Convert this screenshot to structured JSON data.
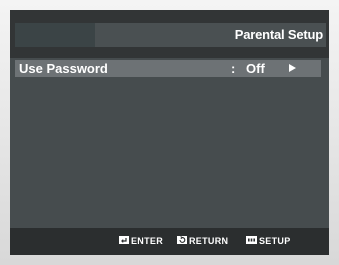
{
  "header": {
    "title": "Parental Setup"
  },
  "menu": {
    "items": [
      {
        "label": "Use Password",
        "separator": ":",
        "value": "Off",
        "arrow_icon": "right-arrow-icon"
      }
    ]
  },
  "footer": {
    "hints": [
      {
        "icon": "enter-icon",
        "label": "ENTER"
      },
      {
        "icon": "return-icon",
        "label": "RETURN"
      },
      {
        "icon": "setup-icon",
        "label": "SETUP"
      }
    ]
  },
  "colors": {
    "screen_background": "#3a3d3e",
    "header_bar": "#4a5052",
    "selected_row": "#6d7275",
    "text": "#ffffff"
  }
}
